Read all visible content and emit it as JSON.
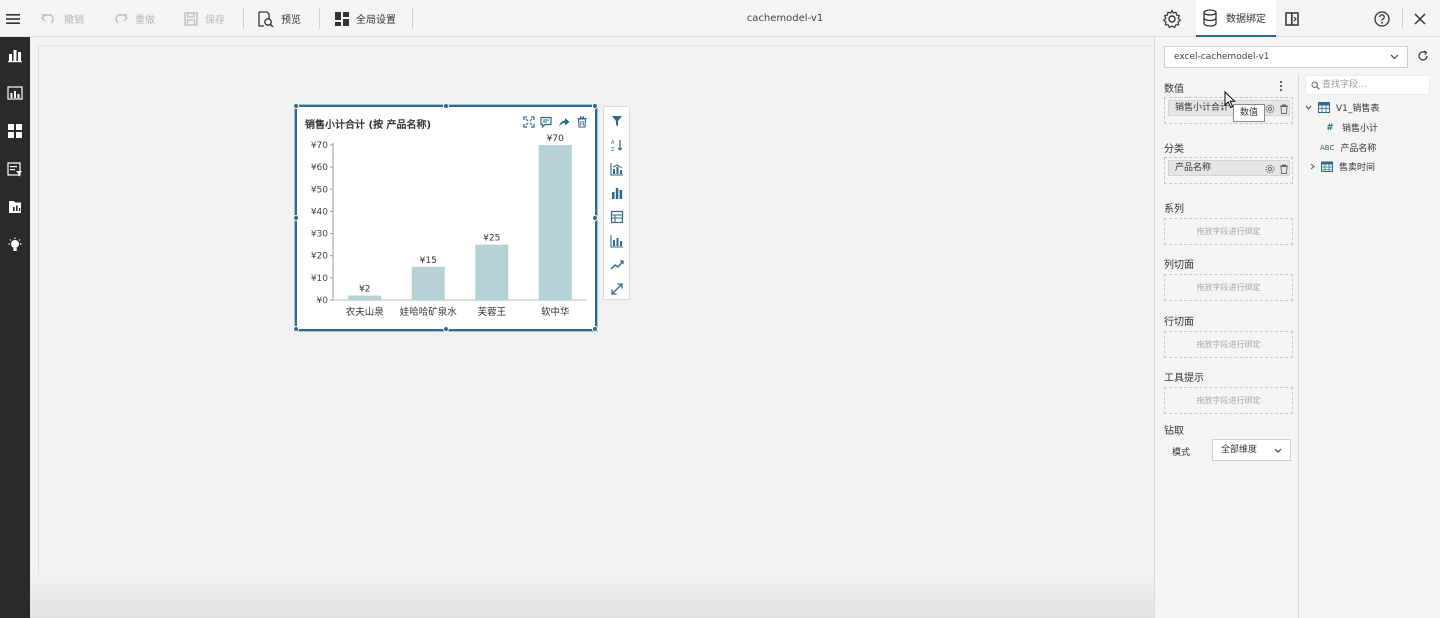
{
  "toolbar": {
    "undo_label": "撤销",
    "redo_label": "重做",
    "save_label": "保存",
    "preview_label": "预览",
    "global_settings_label": "全局设置",
    "document_title": "cachemodel-v1",
    "data_binding_tab_label": "数据绑定"
  },
  "chart": {
    "title": "销售小计合计 (按 产品名称)"
  },
  "chart_data": {
    "type": "bar",
    "title": "销售小计合计 (按 产品名称)",
    "categories": [
      "农夫山泉",
      "娃哈哈矿泉水",
      "芙蓉王",
      "软中华"
    ],
    "values": [
      2,
      15,
      25,
      70
    ],
    "data_labels": [
      "¥2",
      "¥15",
      "¥25",
      "¥70"
    ],
    "y_ticks": [
      "¥0",
      "¥10",
      "¥20",
      "¥30",
      "¥40",
      "¥50",
      "¥60",
      "¥70"
    ],
    "ylim": [
      0,
      70
    ],
    "bar_color": "#b5d0d6",
    "xlabel": "",
    "ylabel": ""
  },
  "panel": {
    "datasource": "excel-cachemodel-v1",
    "values_label": "数值",
    "values_chip": "销售小计合计",
    "tooltip_text": "数值",
    "category_label": "分类",
    "category_chip": "产品名称",
    "series_label": "系列",
    "column_facet_label": "列切面",
    "row_facet_label": "行切面",
    "tooltip_section_label": "工具提示",
    "drop_placeholder": "拖放字段进行绑定",
    "drill_label": "钻取",
    "mode_label": "模式",
    "mode_value": "全部维度",
    "search_placeholder": "查找字段...",
    "fields": {
      "table_name": "V1_销售表",
      "field_1": "销售小计",
      "field_2": "产品名称",
      "field_3": "售卖时间",
      "type_abc": "ABC"
    }
  },
  "colors": {
    "accent": "#2e6b8a",
    "sidebar_bg": "#2a2a2a",
    "bar": "#b5d0d6"
  }
}
